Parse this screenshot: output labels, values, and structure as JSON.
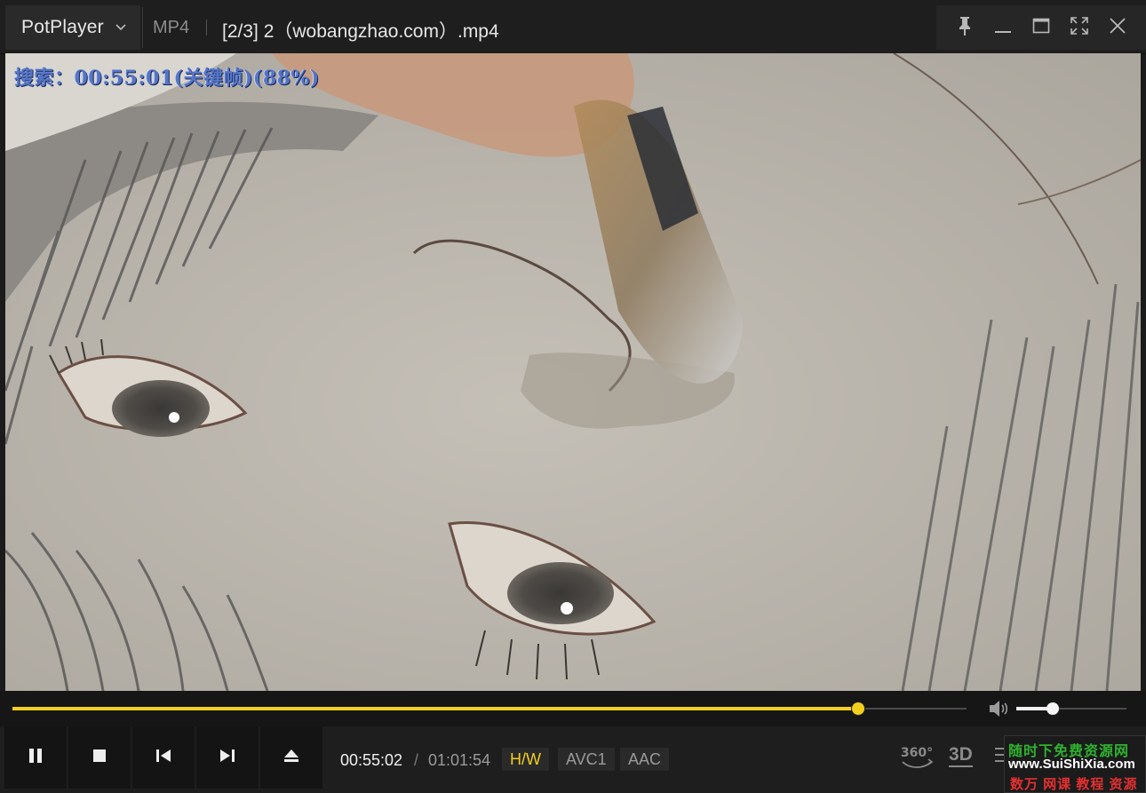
{
  "titlebar": {
    "brand": "PotPlayer",
    "format": "MP4",
    "title": "[2/3] 2（wobangzhao.com）.mp4"
  },
  "icons": {
    "menu": "chevron-down-icon",
    "pin": "pin-icon",
    "minimize": "minimize-icon",
    "maximize": "maximize-icon",
    "fullscreen": "fullscreen-icon",
    "close": "close-icon"
  },
  "osd": {
    "text": "搜索：00:55:01(关键帧)(88%)"
  },
  "seek": {
    "progress": 0.886,
    "volume": 0.33
  },
  "playback": {
    "current_time": "00:55:02",
    "separator": "/",
    "total_time": "01:01:54",
    "decoder": "H/W",
    "video_codec": "AVC1",
    "audio_codec": "AAC"
  },
  "right_controls": {
    "vr": "360°",
    "stereo": "3D"
  },
  "watermark": {
    "line1": "随时下免费资源网",
    "line2": "www.SuiShiXia.com",
    "line3": "数万 网课 教程 资源"
  },
  "colors": {
    "accent": "#f2cf1d",
    "osd": "#5575c8"
  }
}
